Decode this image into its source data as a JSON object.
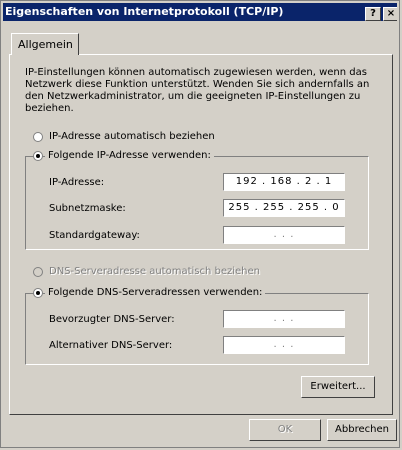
{
  "window": {
    "title": "Eigenschaften von Internetprotokoll (TCP/IP)",
    "help_glyph": "?",
    "close_glyph": "×"
  },
  "tab": {
    "label": "Allgemein"
  },
  "intro": "IP-Einstellungen können automatisch zugewiesen werden, wenn das Netzwerk diese Funktion unterstützt. Wenden Sie sich andernfalls an den Netzwerkadministrator, um die geeigneten IP-Einstellungen zu beziehen.",
  "ip_mode": {
    "auto_label": "IP-Adresse automatisch beziehen",
    "manual_label": "Folgende IP-Adresse verwenden:",
    "selected": "manual"
  },
  "ip_fields": {
    "ip_label": "IP-Adresse:",
    "ip_value": "192 . 168 .  2  .  1",
    "mask_label": "Subnetzmaske:",
    "mask_value": "255 . 255 . 255 .  0",
    "gateway_label": "Standardgateway:",
    "gateway_value": ".      .      ."
  },
  "dns_mode": {
    "auto_label": "DNS-Serveradresse automatisch beziehen",
    "manual_label": "Folgende DNS-Serveradressen verwenden:",
    "selected": "manual"
  },
  "dns_fields": {
    "preferred_label": "Bevorzugter DNS-Server:",
    "preferred_value": ".      .      .",
    "alternate_label": "Alternativer DNS-Server:",
    "alternate_value": ".      .      ."
  },
  "buttons": {
    "advanced": "Erweitert...",
    "ok": "OK",
    "cancel": "Abbrechen"
  },
  "colors": {
    "titlebar": "#0a246a",
    "face": "#d4d0c8"
  }
}
